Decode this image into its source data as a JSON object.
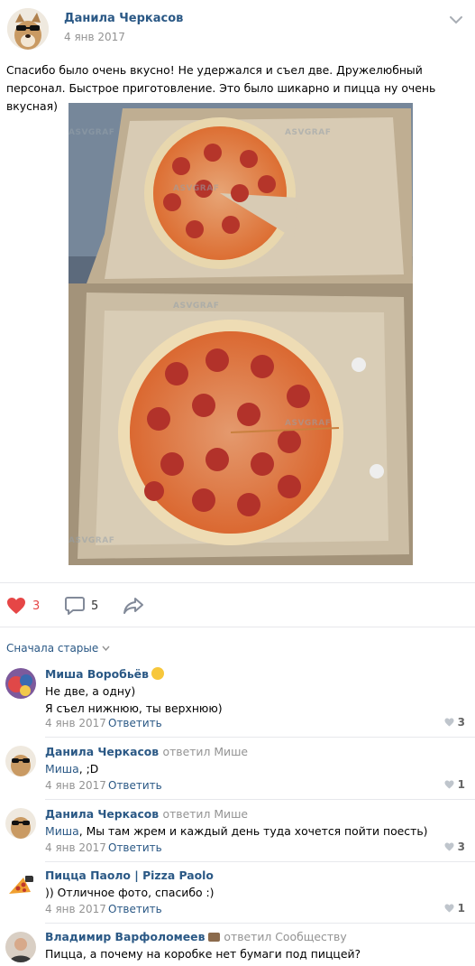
{
  "post": {
    "author": "Данила Черкасов",
    "date": "4 янв 2017",
    "text": "Спасибо было очень вкусно! Не удержался и съел две. Дружелюбный персонал. Быстрое приготовление. Это было шикарно и пицца ну очень вкусная)",
    "watermark": "ASVGRAF"
  },
  "actions": {
    "likes": "3",
    "comments": "5"
  },
  "sort_label": "Сначала старые",
  "comments": [
    {
      "name": "Миша Воробьёв",
      "replied": "",
      "lines": [
        "Не две, а одну)",
        "Я съел нижнюю, ты верхнюю)"
      ],
      "date": "4 янв 2017",
      "reply_label": "Ответить",
      "likes": "3"
    },
    {
      "name": "Данила Черкасов",
      "replied": "ответил Мише",
      "mention": "Миша",
      "lines": [
        ", ;D"
      ],
      "date": "4 янв 2017",
      "reply_label": "Ответить",
      "likes": "1"
    },
    {
      "name": "Данила Черкасов",
      "replied": "ответил Мише",
      "mention": "Миша",
      "lines": [
        ", Мы там жрем и каждый день туда хочется пойти поесть)"
      ],
      "date": "4 янв 2017",
      "reply_label": "Ответить",
      "likes": "3"
    },
    {
      "name": "Пицца Паоло | Pizza Paolo",
      "replied": "",
      "lines": [
        ")) Отличное фото, спасибо :)"
      ],
      "date": "4 янв 2017",
      "reply_label": "Ответить",
      "likes": "1"
    },
    {
      "name": "Владимир Варфоломеев",
      "replied": "ответил Сообществу",
      "lines": [
        "Пицца, а почему на коробке нет бумаги под пиццей?"
      ],
      "date": "",
      "reply_label": "",
      "likes": ""
    }
  ],
  "colors": {
    "link": "#2a5885",
    "like": "#e64646",
    "meta": "#939393"
  }
}
